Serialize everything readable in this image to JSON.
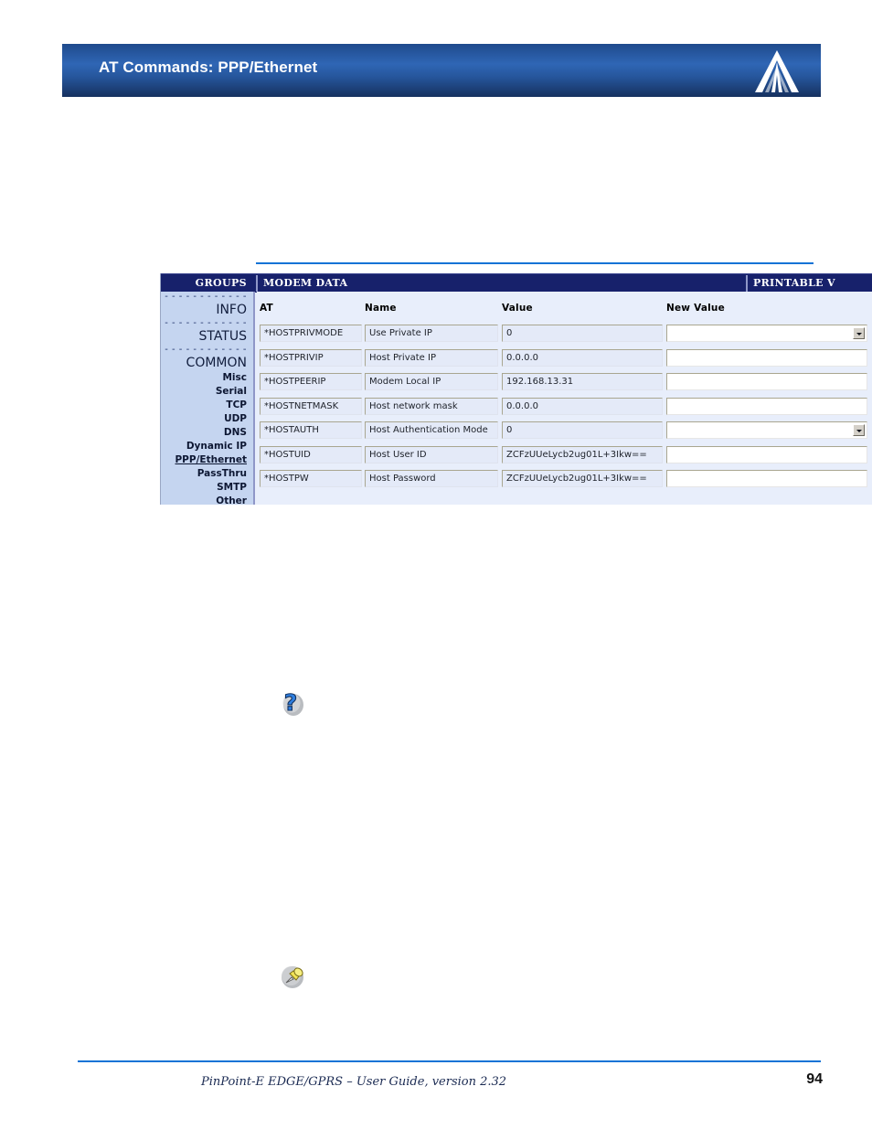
{
  "header": {
    "title": "AT Commands: PPP/Ethernet",
    "logo_name": "sierra-wireless-logo",
    "background_color": "#2f66b5"
  },
  "figure": {
    "titlebar": {
      "groups_label": "GROUPS",
      "page_label": "MODEM DATA",
      "printable_label": "PRINTABLE V"
    },
    "nav": {
      "divider": "- - - - - - - - - - - - -",
      "groups": [
        "INFO",
        "STATUS",
        "COMMON"
      ],
      "items": [
        {
          "label": "Misc",
          "selected": false
        },
        {
          "label": "Serial",
          "selected": false
        },
        {
          "label": "TCP",
          "selected": false
        },
        {
          "label": "UDP",
          "selected": false
        },
        {
          "label": "DNS",
          "selected": false
        },
        {
          "label": "Dynamic IP",
          "selected": false
        },
        {
          "label": "PPP/Ethernet",
          "selected": true
        },
        {
          "label": "PassThru",
          "selected": false
        },
        {
          "label": "SMTP",
          "selected": false
        },
        {
          "label": "Other",
          "selected": false
        }
      ]
    },
    "columns": [
      "AT",
      "Name",
      "Value",
      "New Value"
    ],
    "rows": [
      {
        "at": "*HOSTPRIVMODE",
        "name": "Use Private IP",
        "value": "0",
        "new_value": "",
        "new_value_type": "select"
      },
      {
        "at": "*HOSTPRIVIP",
        "name": "Host Private IP",
        "value": "0.0.0.0",
        "new_value": "",
        "new_value_type": "text"
      },
      {
        "at": "*HOSTPEERIP",
        "name": "Modem Local IP",
        "value": "192.168.13.31",
        "new_value": "",
        "new_value_type": "text"
      },
      {
        "at": "*HOSTNETMASK",
        "name": "Host network mask",
        "value": "0.0.0.0",
        "new_value": "",
        "new_value_type": "text"
      },
      {
        "at": "*HOSTAUTH",
        "name": "Host Authentication Mode",
        "value": "0",
        "new_value": "",
        "new_value_type": "select"
      },
      {
        "at": "*HOSTUID",
        "name": "Host User ID",
        "value": "ZCFzUUeLycb2ug01L+3Ikw==",
        "new_value": "",
        "new_value_type": "text"
      },
      {
        "at": "*HOSTPW",
        "name": "Host Password",
        "value": "ZCFzUUeLycb2ug01L+3Ikw==",
        "new_value": "",
        "new_value_type": "text"
      }
    ]
  },
  "body_icons": [
    {
      "name": "tip-question-icon",
      "color": "#2f7fe0"
    },
    {
      "name": "note-pushpin-icon",
      "color": "#f2e355"
    }
  ],
  "footer": {
    "text": "PinPoint-E EDGE/GPRS – User Guide, version 2.32",
    "page_number": "94",
    "rule_color": "#1273d6"
  }
}
